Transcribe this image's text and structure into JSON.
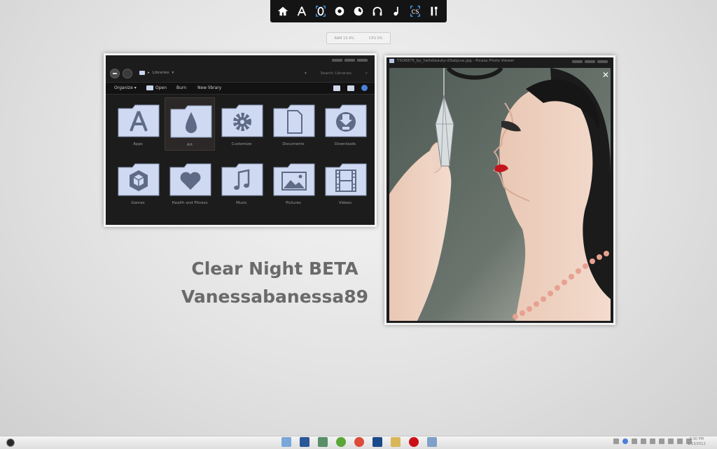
{
  "meter": {
    "ram": "RAM 15.4%",
    "cpu": "CPU 0%"
  },
  "explorer": {
    "address_label": "Libraries",
    "search_placeholder": "Search Libraries",
    "commands": {
      "organize": "Organize ▾",
      "open": "Open",
      "burn": "Burn",
      "new_library": "New library"
    },
    "folders": [
      {
        "label": "Apps",
        "icon": "app-store-icon"
      },
      {
        "label": "Art",
        "icon": "droplet-icon"
      },
      {
        "label": "Customize",
        "icon": "gear-icon"
      },
      {
        "label": "Documents",
        "icon": "document-icon"
      },
      {
        "label": "Downloads",
        "icon": "download-icon"
      },
      {
        "label": "Games",
        "icon": "cube-icon"
      },
      {
        "label": "Health and Fitness",
        "icon": "heart-icon"
      },
      {
        "label": "Music",
        "icon": "music-note-icon"
      },
      {
        "label": "Pictures",
        "icon": "picture-icon"
      },
      {
        "label": "Videos",
        "icon": "film-icon"
      }
    ]
  },
  "picasa": {
    "title": "TSO6875_by_hellsbeauty-d3abjsue.jpg - Picasa Photo Viewer"
  },
  "headline": {
    "line1": "Clear Night BETA",
    "line2": "Vanessabanessa89"
  },
  "clock": {
    "time": "3:30 PM",
    "date": "1/13/2012"
  },
  "colors": {
    "folder_fill": "#cfd9f2",
    "folder_glyph": "#5f6b86",
    "window_bg": "#1c1c1c"
  }
}
